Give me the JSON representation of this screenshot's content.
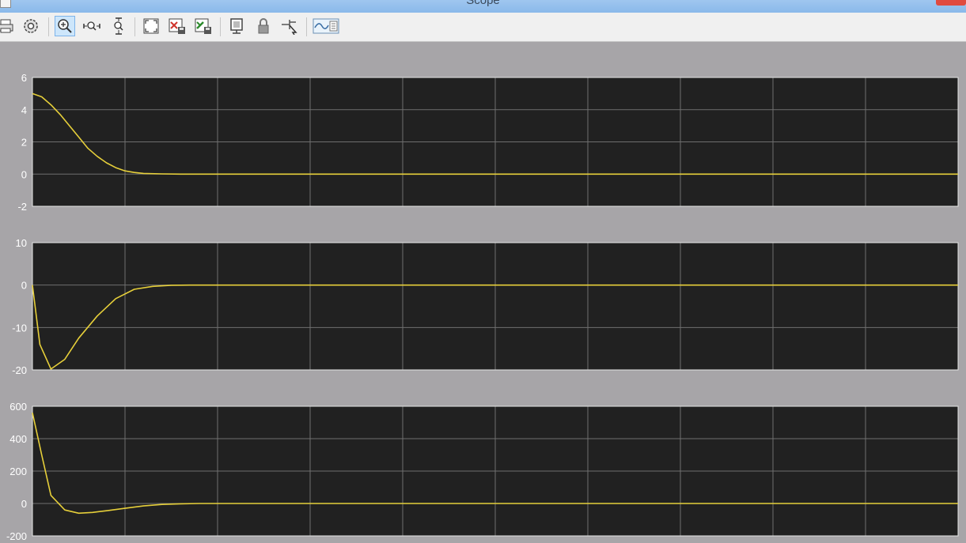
{
  "window": {
    "title": "Scope"
  },
  "toolbar": {
    "tools": [
      {
        "name": "print-icon"
      },
      {
        "name": "settings-icon"
      },
      {
        "name": "zoom-in-icon",
        "active": true
      },
      {
        "name": "zoom-x-icon"
      },
      {
        "name": "zoom-y-icon"
      },
      {
        "name": "autoscale-icon"
      },
      {
        "name": "save-axes-settings-icon"
      },
      {
        "name": "restore-axes-settings-icon"
      },
      {
        "name": "floating-scope-icon"
      },
      {
        "name": "lock-axes-icon"
      },
      {
        "name": "signal-selection-icon"
      },
      {
        "name": "legend-icon"
      }
    ]
  },
  "colors": {
    "figure_bg": "#a7a5a8",
    "axes_bg": "#212121",
    "grid": "#6f6f6f",
    "axis_line": "#e6e6e6",
    "trace": "#e6cf3a"
  },
  "chart_data": [
    {
      "type": "line",
      "ylim": [
        -2,
        6
      ],
      "yticks": [
        "6",
        "4",
        "2",
        "0",
        "-2"
      ],
      "xlim": [
        0,
        10
      ],
      "grid": true,
      "x": [
        0,
        0.1,
        0.2,
        0.3,
        0.4,
        0.5,
        0.6,
        0.7,
        0.8,
        0.9,
        1.0,
        1.1,
        1.2,
        1.4,
        1.6,
        2.0,
        3.0,
        5.0,
        10.0
      ],
      "values": [
        5.0,
        4.8,
        4.3,
        3.7,
        3.0,
        2.3,
        1.6,
        1.1,
        0.7,
        0.4,
        0.2,
        0.1,
        0.04,
        0.01,
        0.0,
        0.0,
        0.0,
        0.0,
        0.0
      ]
    },
    {
      "type": "line",
      "ylim": [
        -20,
        10
      ],
      "yticks": [
        "10",
        "0",
        "-10",
        "-20"
      ],
      "xlim": [
        0,
        10
      ],
      "grid": true,
      "x": [
        0,
        0.08,
        0.2,
        0.35,
        0.5,
        0.7,
        0.9,
        1.1,
        1.3,
        1.5,
        1.7,
        2.0,
        3.0,
        5.0,
        10.0
      ],
      "values": [
        0,
        -14,
        -19.8,
        -17.5,
        -12.5,
        -7.3,
        -3.2,
        -1.0,
        -0.3,
        -0.05,
        0.0,
        0.0,
        0.0,
        0.0,
        0.0
      ]
    },
    {
      "type": "line",
      "ylim": [
        -200,
        600
      ],
      "yticks": [
        "600",
        "400",
        "200",
        "0",
        "-200"
      ],
      "xlim": [
        0,
        10
      ],
      "grid": true,
      "x": [
        0,
        0.1,
        0.2,
        0.35,
        0.5,
        0.65,
        0.8,
        1.0,
        1.2,
        1.4,
        1.6,
        1.8,
        2.0,
        3.0,
        5.0,
        10.0
      ],
      "values": [
        560,
        300,
        50,
        -40,
        -60,
        -55,
        -45,
        -30,
        -15,
        -6,
        -2,
        0,
        0,
        0,
        0,
        0
      ]
    }
  ]
}
